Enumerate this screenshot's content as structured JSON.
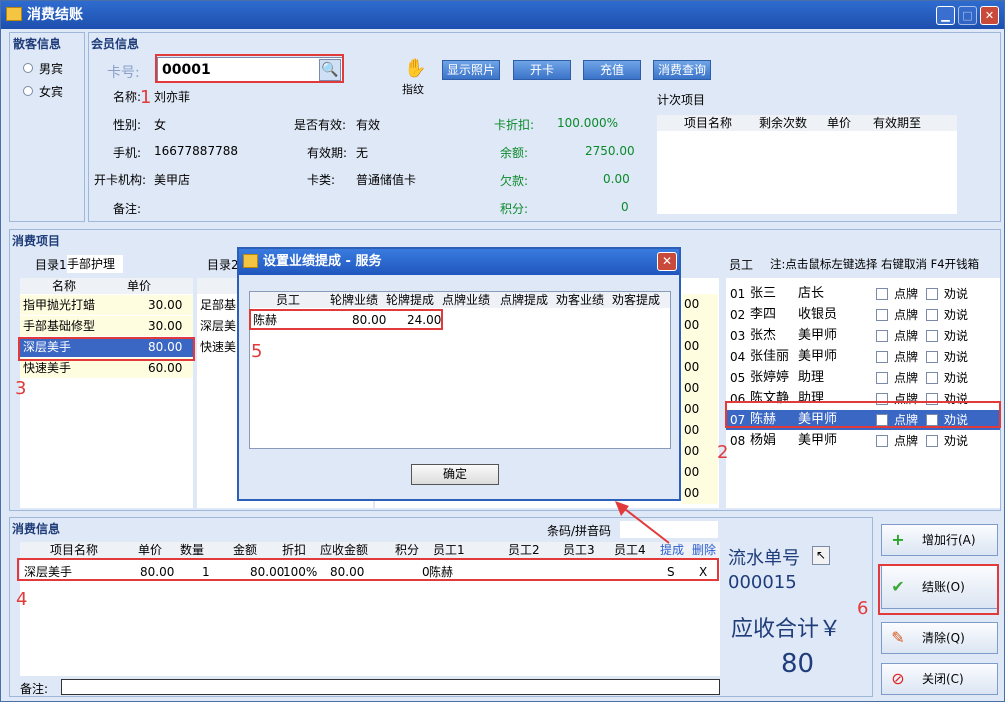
{
  "window": {
    "title": "消费结账",
    "min": "▁",
    "max": "□",
    "close": "✕"
  },
  "guest": {
    "header": "散客信息",
    "male": "男宾",
    "female": "女宾"
  },
  "member": {
    "header": "会员信息",
    "card_label": "卡号:",
    "card_value": "00001",
    "finger_label": "指纹",
    "show_photo": "显示照片",
    "open_card": "开卡",
    "recharge": "充值",
    "consume_query": "消费查询",
    "name_label": "名称:",
    "name_value": "刘亦菲",
    "gender_label": "性别:",
    "gender_value": "女",
    "phone_label": "手机:",
    "phone_value": "16677887788",
    "org_label": "开卡机构:",
    "org_value": "美甲店",
    "note_label": "备注:",
    "valid_label": "是否有效:",
    "valid_value": "有效",
    "period_label": "有效期:",
    "period_value": "无",
    "type_label": "卡类:",
    "type_value": "普通储值卡",
    "discount_label": "卡折扣:",
    "discount_value": "100.000%",
    "balance_label": "余额:",
    "balance_value": "2750.00",
    "debt_label": "欠款:",
    "debt_value": "0.00",
    "points_label": "积分:",
    "points_value": "0",
    "count_title": "计次项目",
    "count_cols": [
      "项目名称",
      "剩余次数",
      "单价",
      "有效期至"
    ]
  },
  "consume": {
    "header": "消费项目",
    "cat1_label": "目录1",
    "cat1_value": "手部护理",
    "cat2_label": "目录2",
    "cols": [
      "名称",
      "单价"
    ],
    "items": [
      [
        "指甲抛光打蜡",
        "30.00"
      ],
      [
        "手部基础修型",
        "30.00"
      ],
      [
        "深层美手",
        "80.00"
      ],
      [
        "快速美手",
        "60.00"
      ]
    ],
    "list2": [
      "足部基",
      "深层美",
      "快速美"
    ],
    "list2_prices": [
      "00",
      "00",
      "00",
      "00",
      "00",
      "00",
      "00",
      "00",
      "00",
      "00"
    ]
  },
  "staff": {
    "header": "员工",
    "note": "注:点击鼠标左键选择 右键取消 F4开钱箱",
    "rows": [
      [
        "01",
        "张三",
        "店长"
      ],
      [
        "02",
        "李四",
        "收银员"
      ],
      [
        "03",
        "张杰",
        "美甲师"
      ],
      [
        "04",
        "张佳丽",
        "美甲师"
      ],
      [
        "05",
        "张婷婷",
        "助理"
      ],
      [
        "06",
        "陈文静",
        "助理"
      ],
      [
        "07",
        "陈赫",
        "美甲师"
      ],
      [
        "08",
        "杨娟",
        "美甲师"
      ]
    ],
    "paiLabel": "点牌",
    "shuoLabel": "劝说"
  },
  "info": {
    "header": "消费信息",
    "barcode_label": "条码/拼音码",
    "cols": [
      "项目名称",
      "单价",
      "数量",
      "金额",
      "折扣",
      "应收金额",
      "积分",
      "员工1",
      "员工2",
      "员工3",
      "员工4",
      "提成",
      "删除"
    ],
    "row": [
      "深层美手",
      "80.00",
      "1",
      "80.00",
      "100%",
      "80.00",
      "0",
      "陈赫",
      "",
      "",
      "",
      "S",
      "X"
    ],
    "note_label": "备注:"
  },
  "side": {
    "serial_label": "流水单号",
    "serial_value": "000015",
    "total_label": "应收合计￥",
    "total_value": "80",
    "add_row": "增加行(A)",
    "checkout": "结账(O)",
    "clear": "清除(Q)",
    "close": "关闭(C)"
  },
  "dialog": {
    "title": "设置业绩提成 - 服务",
    "cols": [
      "员工",
      "轮牌业绩",
      "轮牌提成",
      "点牌业绩",
      "点牌提成",
      "劝客业绩",
      "劝客提成"
    ],
    "row": [
      "陈赫",
      "80.00",
      "24.00",
      "",
      "",
      "",
      ""
    ],
    "ok": "确定"
  },
  "markers": [
    "1",
    "2",
    "3",
    "4",
    "5",
    "6"
  ]
}
